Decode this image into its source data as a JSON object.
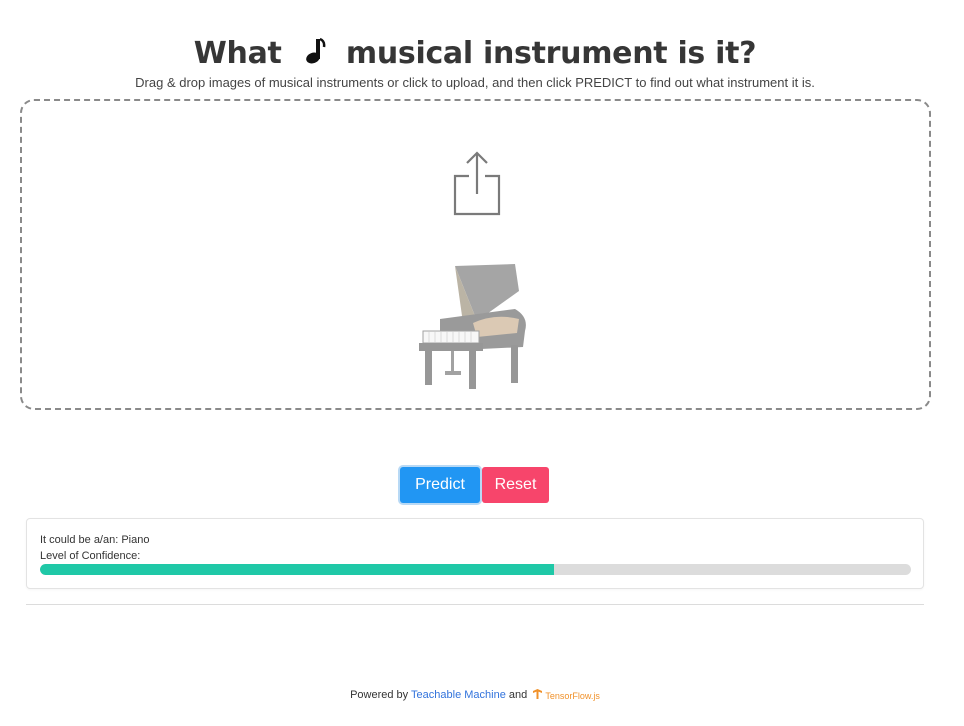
{
  "header": {
    "title_before": "What",
    "title_icon": "music-note-icon",
    "title_after": "musical instrument is it?",
    "subtitle": "Drag & drop images of musical instruments or click to upload, and then click PREDICT to find out what instrument it is."
  },
  "dropzone": {
    "upload_icon": "upload-share-icon",
    "preview_image": "grand-piano-image"
  },
  "actions": {
    "predict_label": "Predict",
    "reset_label": "Reset"
  },
  "result": {
    "prediction_text": "It could be a/an: Piano",
    "confidence_label": "Level of Confidence:",
    "confidence_fraction": 0.59
  },
  "footer": {
    "powered_by": "Powered by",
    "link_text": "Teachable Machine",
    "and_text": "and",
    "logo_text": "TensorFlow.js"
  },
  "colors": {
    "predict": "#2196f3",
    "reset": "#f7456b",
    "confidence_fill": "#1fc8a7",
    "confidence_track": "#dcdcdc",
    "link": "#3273dc",
    "tensorflow_orange": "#f0912a"
  }
}
